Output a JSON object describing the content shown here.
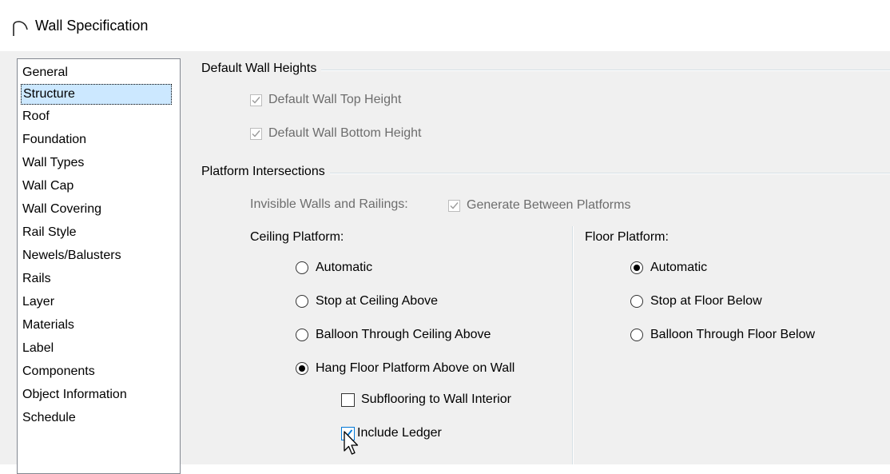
{
  "window": {
    "title": "Wall Specification",
    "icon": "arch-icon"
  },
  "sidebar": {
    "items": [
      {
        "label": "General"
      },
      {
        "label": "Structure",
        "selected": true
      },
      {
        "label": "Roof"
      },
      {
        "label": "Foundation"
      },
      {
        "label": "Wall Types"
      },
      {
        "label": "Wall Cap"
      },
      {
        "label": "Wall Covering"
      },
      {
        "label": "Rail Style"
      },
      {
        "label": "Newels/Balusters"
      },
      {
        "label": "Rails"
      },
      {
        "label": "Layer"
      },
      {
        "label": "Materials"
      },
      {
        "label": "Label"
      },
      {
        "label": "Components"
      },
      {
        "label": "Object Information"
      },
      {
        "label": "Schedule"
      }
    ]
  },
  "default_wall_heights": {
    "group_label": "Default Wall Heights",
    "top_height": {
      "label": "Default Wall Top Height",
      "checked": true,
      "enabled": false
    },
    "bottom_height": {
      "label": "Default Wall Bottom Height",
      "checked": true,
      "enabled": false
    }
  },
  "platform_intersections": {
    "group_label": "Platform Intersections",
    "invisible_label": "Invisible Walls and Railings:",
    "generate_between": {
      "label": "Generate Between Platforms",
      "checked": true,
      "enabled": false
    },
    "ceiling": {
      "label": "Ceiling Platform:",
      "options": [
        "Automatic",
        "Stop at Ceiling Above",
        "Balloon Through Ceiling Above",
        "Hang Floor Platform Above on Wall"
      ],
      "selected": "Hang Floor Platform Above on Wall",
      "subflooring": {
        "label": "Subflooring to Wall Interior",
        "checked": false
      },
      "include_ledger": {
        "label": "Include Ledger",
        "checked": true
      }
    },
    "floor": {
      "label": "Floor Platform:",
      "options": [
        "Automatic",
        "Stop at Floor Below",
        "Balloon Through Floor Below"
      ],
      "selected": "Automatic"
    }
  },
  "colors": {
    "selection": "#cce8ff",
    "focus_border": "#0078d7",
    "dialog_bg": "#f0f0f0"
  }
}
